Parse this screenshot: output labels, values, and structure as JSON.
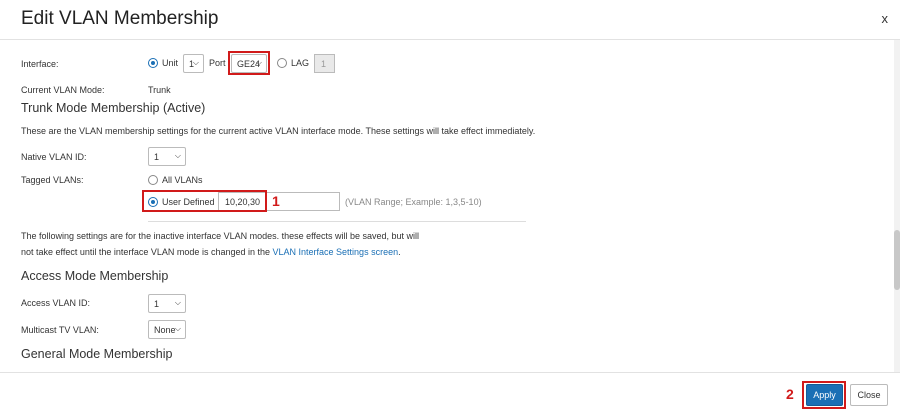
{
  "dialog": {
    "title": "Edit VLAN Membership",
    "close_label": "x"
  },
  "interface": {
    "label": "Interface:",
    "unit_label": "Unit",
    "unit_value": "1",
    "port_label": "Port",
    "port_value": "GE24",
    "lag_label": "LAG",
    "lag_value": "1"
  },
  "current_mode": {
    "label": "Current VLAN Mode:",
    "value": "Trunk"
  },
  "trunk": {
    "heading": "Trunk Mode Membership (Active)",
    "description": "These are the VLAN membership settings for the current active VLAN interface mode. These settings will take effect immediately.",
    "native_label": "Native VLAN ID:",
    "native_value": "1",
    "tagged_label": "Tagged VLANs:",
    "all_vlans_label": "All VLANs",
    "user_defined_label": "User Defined",
    "user_defined_value": "10,20,30",
    "range_hint": "(VLAN Range; Example: 1,3,5-10)"
  },
  "inactive_note": {
    "line1": "The following settings are for the inactive interface VLAN modes. these effects will be saved, but will",
    "line2_prefix": "not take effect until the interface VLAN mode is changed in the",
    "link": "VLAN Interface Settings screen",
    "line2_suffix": "."
  },
  "access": {
    "heading": "Access Mode Membership",
    "vlan_label": "Access VLAN ID:",
    "vlan_value": "1",
    "multicast_label": "Multicast TV VLAN:",
    "multicast_value": "None"
  },
  "general": {
    "heading": "General Mode Membership"
  },
  "footer": {
    "apply_label": "Apply",
    "close_label": "Close"
  },
  "annotations": {
    "step1": "1",
    "step2": "2"
  },
  "colors": {
    "accent": "#1a6fb5",
    "highlight": "#d11a1a"
  }
}
